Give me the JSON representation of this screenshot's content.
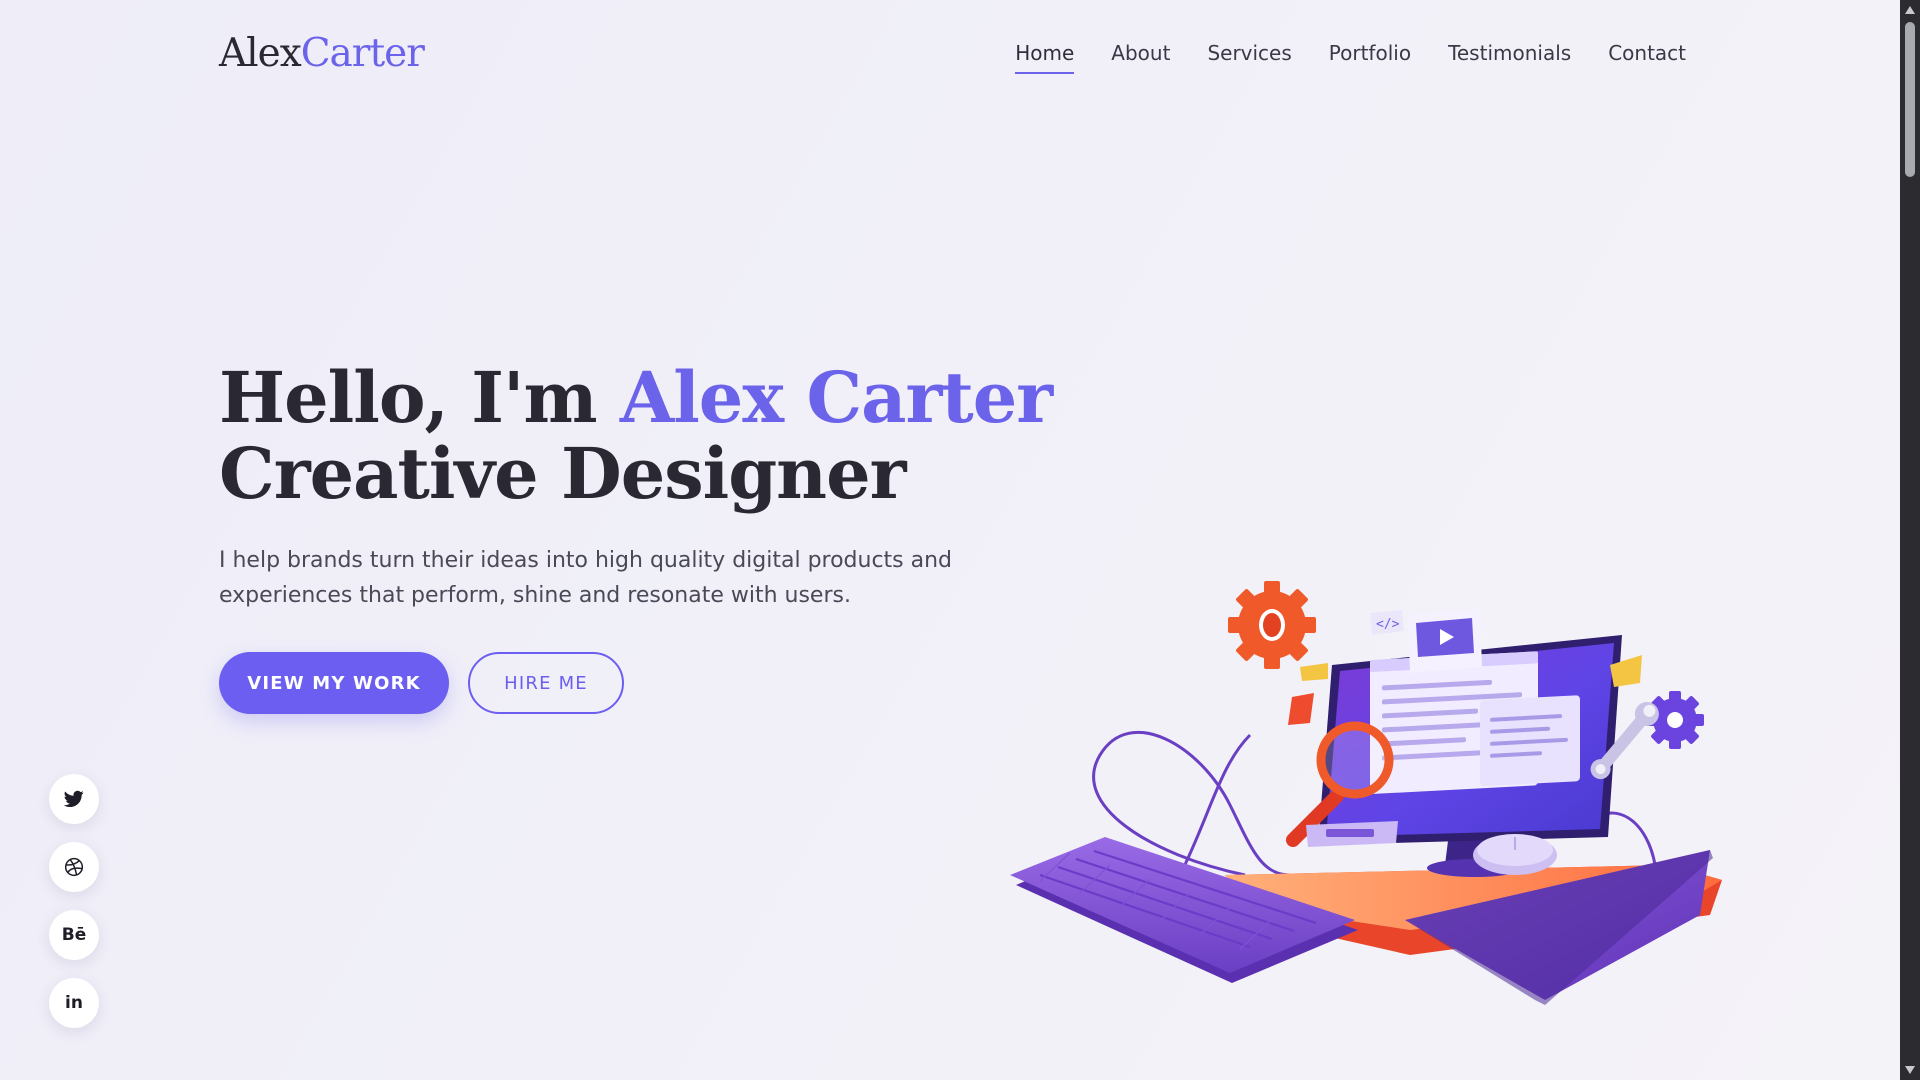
{
  "logo": {
    "first": "Alex",
    "last": "Carter"
  },
  "nav": {
    "items": [
      {
        "label": "Home",
        "active": true
      },
      {
        "label": "About"
      },
      {
        "label": "Services"
      },
      {
        "label": "Portfolio"
      },
      {
        "label": "Testimonials"
      },
      {
        "label": "Contact"
      }
    ]
  },
  "hero": {
    "greeting": "Hello, I'm",
    "name": "Alex Carter",
    "role": "Creative Designer",
    "description": "I help brands turn their ideas into high quality digital products and experiences that perform, shine and resonate with users.",
    "primary_cta": "VIEW MY WORK",
    "secondary_cta": "HIRE ME"
  },
  "social": [
    {
      "icon": "twitter-icon"
    },
    {
      "icon": "dribbble-icon"
    },
    {
      "icon": "behance-icon",
      "label": "Bē"
    },
    {
      "icon": "linkedin-icon",
      "label": "in"
    }
  ],
  "colors": {
    "accent": "#6b63ea",
    "button": "#6b5ef0",
    "text_dark": "#2a2933",
    "background": "#f1f0f8"
  }
}
